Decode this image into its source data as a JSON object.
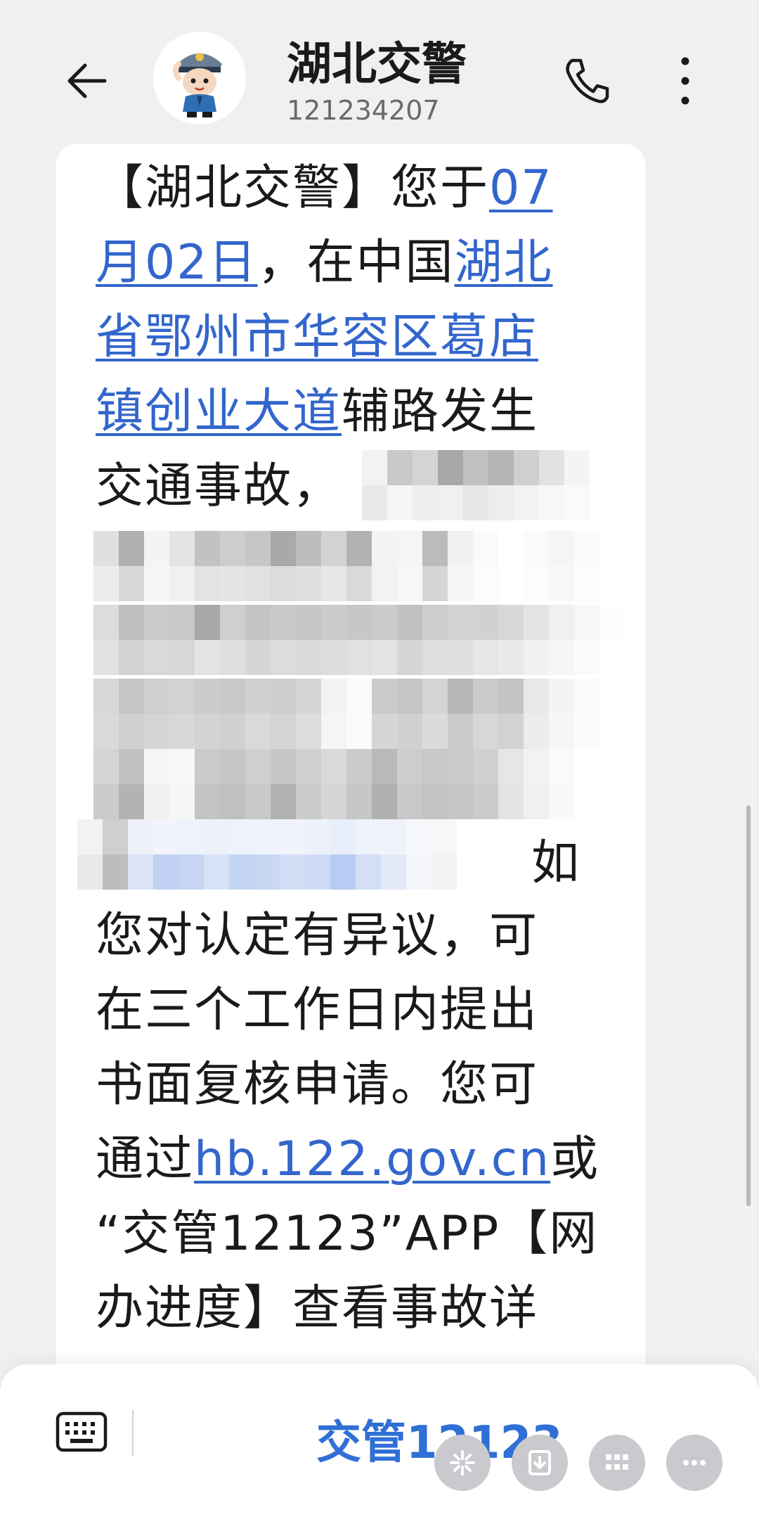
{
  "header": {
    "contact_name": "湖北交警",
    "contact_number": "121234207"
  },
  "message": {
    "lines": [
      {
        "pre": "【湖北交警】您于",
        "link": "07",
        "post": ""
      },
      {
        "pre": "",
        "link": "月02日",
        "post": "，在中国"
      },
      {
        "pre": "",
        "link": "湖北",
        "post": ""
      },
      {
        "pre": "",
        "link": "省鄂州市华容区葛店",
        "post": ""
      },
      {
        "pre": "",
        "link": "镇创业大道",
        "post": "辅路发生"
      },
      {
        "pre": "交通事故，",
        "link": "",
        "post": ""
      },
      {
        "pre": "如",
        "link": "",
        "post": ""
      },
      {
        "pre": "您对认定有异议，可",
        "link": "",
        "post": ""
      },
      {
        "pre": "在三个工作日内提出",
        "link": "",
        "post": ""
      },
      {
        "pre": "书面复核申请。您可",
        "link": "",
        "post": ""
      },
      {
        "pre": "通过",
        "link": "hb.122.gov.cn",
        "post": "或"
      },
      {
        "pre": "“交管12123”APP【网",
        "link": "",
        "post": ""
      },
      {
        "pre": "办进度】查看事故详",
        "link": "",
        "post": ""
      }
    ]
  },
  "composer": {
    "quick_reply": "交管12123"
  },
  "icons": {
    "back": "arrow-left-icon",
    "call": "phone-icon",
    "more": "vertical-ellipsis-icon",
    "keyboard": "keyboard-icon",
    "fab1": "sparkle-icon",
    "fab2": "download-icon",
    "fab3": "grid-icon",
    "fab4": "more-horizontal-icon"
  },
  "colors": {
    "link": "#3366cc",
    "quick_reply": "#2f6fd6",
    "background": "#f0f0f3"
  }
}
